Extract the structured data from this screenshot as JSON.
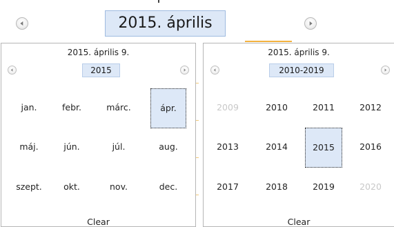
{
  "header": {
    "title": "2015. április"
  },
  "month_view": {
    "current_date": "2015. április 9.",
    "title": "2015",
    "months": [
      "jan.",
      "febr.",
      "márc.",
      "ápr.",
      "máj.",
      "jún.",
      "júl.",
      "aug.",
      "szept.",
      "okt.",
      "nov.",
      "dec."
    ],
    "selected_index": 3,
    "clear_label": "Clear"
  },
  "year_view": {
    "current_date": "2015. április 9.",
    "title": "2010-2019",
    "years": [
      "2009",
      "2010",
      "2011",
      "2012",
      "2013",
      "2014",
      "2015",
      "2016",
      "2017",
      "2018",
      "2019",
      "2020"
    ],
    "selected_index": 6,
    "dim_indices": [
      0,
      11
    ],
    "clear_label": "Clear"
  },
  "icons": {
    "prev": "chevron-left-icon",
    "next": "chevron-right-icon"
  },
  "colors": {
    "selected_fill": "#dde8f7",
    "selected_border": "#222222",
    "accent_underline": "#f2b13e",
    "dim_text": "#c8c8c8"
  }
}
